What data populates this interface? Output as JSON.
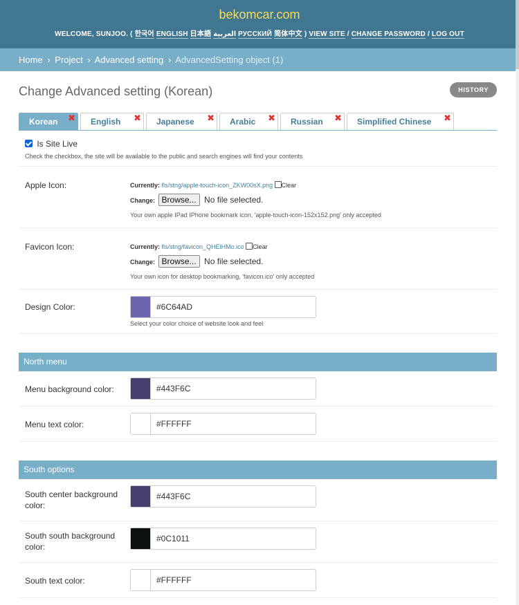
{
  "header": {
    "brand": "bekomcar.com",
    "welcome": "WELCOME,",
    "user": "SUNJOO.",
    "open_paren": "(",
    "languages": [
      "한국어",
      "ENGLISH",
      "日本語",
      "العربية",
      "РУССКИЙ",
      "简体中文"
    ],
    "close_paren": ")",
    "view_site": "VIEW SITE",
    "change_password": "CHANGE PASSWORD",
    "log_out": "LOG OUT",
    "sep": "/"
  },
  "breadcrumbs": {
    "home": "Home",
    "project": "Project",
    "advanced": "Advanced setting",
    "current": "AdvancedSetting object (1)",
    "sep": "›"
  },
  "page": {
    "title": "Change Advanced setting (Korean)",
    "history": "HISTORY"
  },
  "tabs": [
    {
      "label": "Korean",
      "active": true
    },
    {
      "label": "English"
    },
    {
      "label": "Japanese"
    },
    {
      "label": "Arabic"
    },
    {
      "label": "Russian"
    },
    {
      "label": "Simplified Chinese"
    }
  ],
  "tab_remove_icon": "✖",
  "site_live": {
    "label": "Is Site Live",
    "checked": true,
    "help": "Check the checkbox, the site will be available to the public and search engines will find your contents"
  },
  "apple_icon": {
    "label": "Apple Icon:",
    "currently": "Currently:",
    "file": "fls/stng/apple-touch-icon_ZKW00sX.png",
    "clear": "Clear",
    "change": "Change:",
    "browse": "Browse...",
    "no_file": "No file selected.",
    "help": "Your own apple IPad IPhone bookmark icon, 'apple-touch-icon-152x152.png' only accepted"
  },
  "favicon_icon": {
    "label": "Favicon Icon:",
    "currently": "Currently:",
    "file": "fls/stng/favicon_QHElHMo.ico",
    "clear": "Clear",
    "change": "Change:",
    "browse": "Browse...",
    "no_file": "No file selected.",
    "help": "Your own icon for desktop bookmarking, 'favicon.ico' only accepted"
  },
  "design_color": {
    "label": "Design Color:",
    "value": "#6C64AD",
    "help": "Select your color choice of website look and feel"
  },
  "north_menu": {
    "heading": "North menu",
    "bg_label": "Menu background color:",
    "bg_value": "#443F6C",
    "text_label": "Menu text color:",
    "text_value": "#FFFFFF"
  },
  "south_options": {
    "heading": "South options",
    "center_label": "South center background color:",
    "center_value": "#443F6C",
    "south_label": "South south background color:",
    "south_value": "#0C1011",
    "text_label": "South text color:",
    "text_value": "#FFFFFF"
  },
  "colors": {
    "header": "#417690",
    "accent": "#79aec8",
    "brand": "#f5dd5d",
    "remove": "#dd3333"
  }
}
